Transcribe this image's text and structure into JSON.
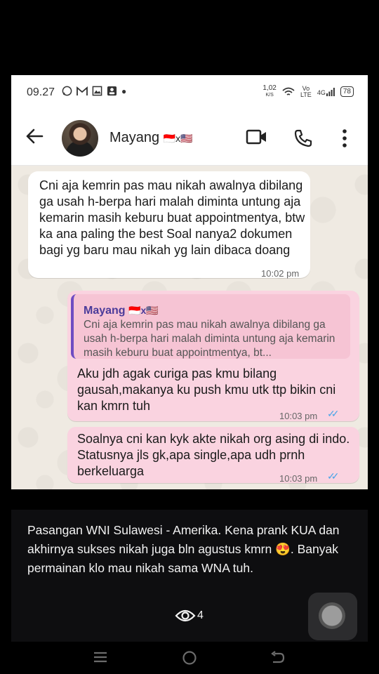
{
  "status_bar": {
    "time": "09.27",
    "notification_icons": [
      "whatsapp-icon",
      "gmail-icon",
      "photo-icon",
      "account-icon"
    ],
    "speed": "1,02",
    "speed_unit": "K/S",
    "volte": "Vo LTE",
    "network": "4G",
    "battery": "78"
  },
  "chat": {
    "contact_name": "Mayang",
    "contact_flags": "🇮🇩x🇺🇸",
    "messages": [
      {
        "direction": "in",
        "text": "Cni aja kemrin pas mau nikah awalnya dibilang ga usah h-berpa hari malah diminta untung aja kemarin masih keburu buat appointmentya, btw ka ana paling the best Soal nanya2 dokumen bagi yg baru mau nikah yg lain dibaca doang",
        "time": "10:02 pm"
      },
      {
        "direction": "out",
        "quote_name": "Mayang",
        "quote_flags": "🇮🇩x🇺🇸",
        "quote_text": "Cni aja kemrin pas mau nikah awalnya dibilang ga usah h-berpa hari malah diminta untung aja kemarin masih keburu buat appointmentya, bt...",
        "text": "Aku jdh agak curiga pas kmu bilang gausah,makanya ku push kmu utk ttp bikin cni kan kmrn tuh",
        "time": "10:03 pm"
      },
      {
        "direction": "out",
        "text": "Soalnya cni kan kyk akte nikah org asing di indo. Statusnya jls gk,apa single,apa udh prnh berkeluarga",
        "time": "10:03 pm"
      }
    ]
  },
  "caption": "Pasangan WNI Sulawesi - Amerika. Kena prank KUA dan akhirnya sukses nikah juga bln agustus kmrn 😍. Banyak permainan klo mau nikah sama WNA tuh.",
  "views": "4",
  "colors": {
    "incoming_bubble": "#ffffff",
    "outgoing_bubble": "#fad3e0",
    "quote_bar": "#6e4cc2",
    "read_ticks": "#4aa5e8",
    "chat_bg": "#efeae2"
  }
}
